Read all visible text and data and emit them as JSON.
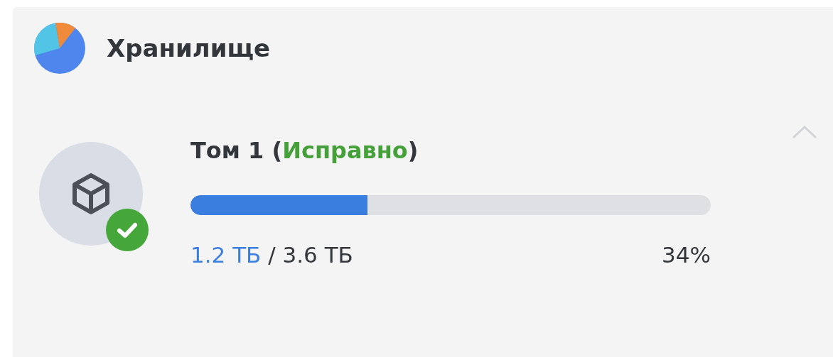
{
  "widget": {
    "title": "Хранилище",
    "expanded": true
  },
  "volume": {
    "name_prefix": "Том 1 (",
    "status": "Исправно",
    "name_suffix": ")",
    "healthy": true,
    "level": 0.34,
    "used": "1.2 ТБ",
    "separator": "/",
    "total": "3.6 ТБ",
    "percent": "34%"
  }
}
